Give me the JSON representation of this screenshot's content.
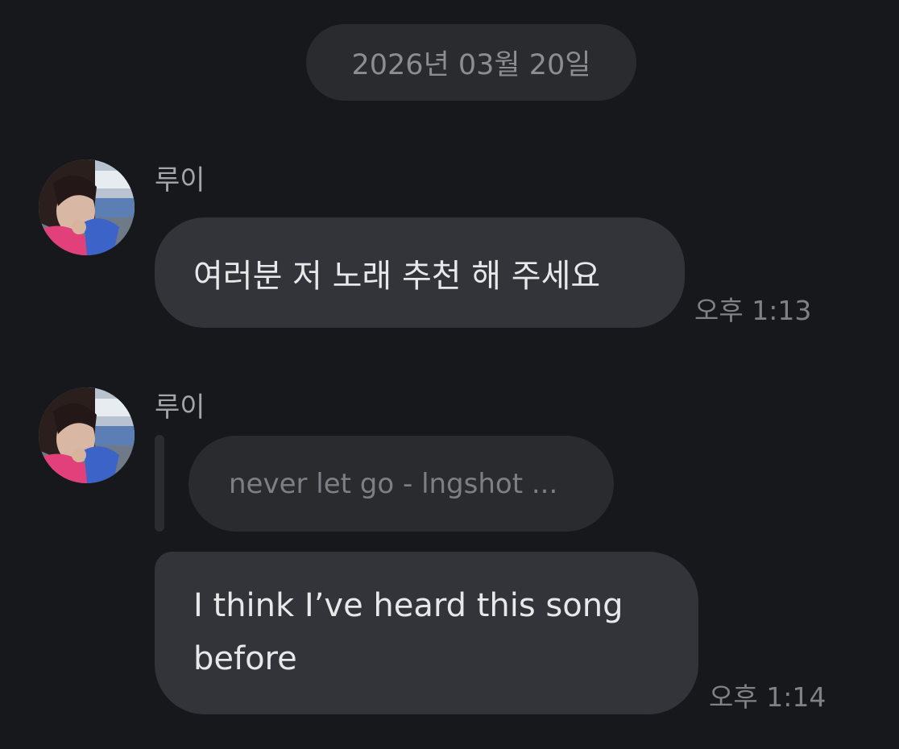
{
  "date_separator": "2026년 03월 20일",
  "messages": [
    {
      "sender": "루이",
      "text": "여러분 저 노래 추천 해 주세요",
      "time": "오후 1:13"
    },
    {
      "sender": "루이",
      "reply_preview": "never let go - lngshot ...",
      "text_line1": "I think I’ve heard this song",
      "text_line2": "before",
      "time": "오후 1:14"
    }
  ]
}
